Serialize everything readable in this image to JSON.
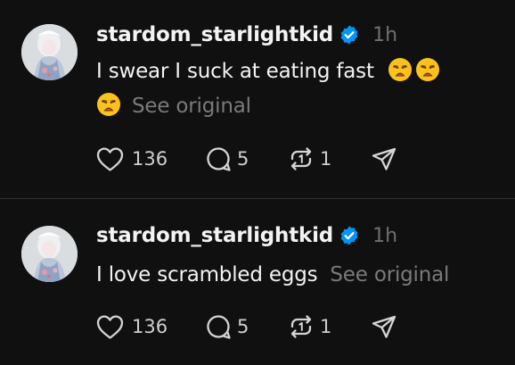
{
  "colors": {
    "background": "#101010",
    "text": "#f3f3f3",
    "muted": "#7a7a7a",
    "verified": "#0095f6",
    "divider": "#2e2e2e"
  },
  "posts": [
    {
      "username": "stardom_starlightkid",
      "verified_icon": "verified-badge-icon",
      "time": "1h",
      "text": "I swear I suck at eating fast",
      "emojis": [
        "weary-face-emoji",
        "weary-face-emoji",
        "weary-face-emoji"
      ],
      "see_original": "See original",
      "likes": "136",
      "replies": "5",
      "reposts": "1"
    },
    {
      "username": "stardom_starlightkid",
      "verified_icon": "verified-badge-icon",
      "time": "1h",
      "text": "I love scrambled eggs",
      "see_original": "See original",
      "likes": "136",
      "replies": "5",
      "reposts": "1"
    }
  ]
}
